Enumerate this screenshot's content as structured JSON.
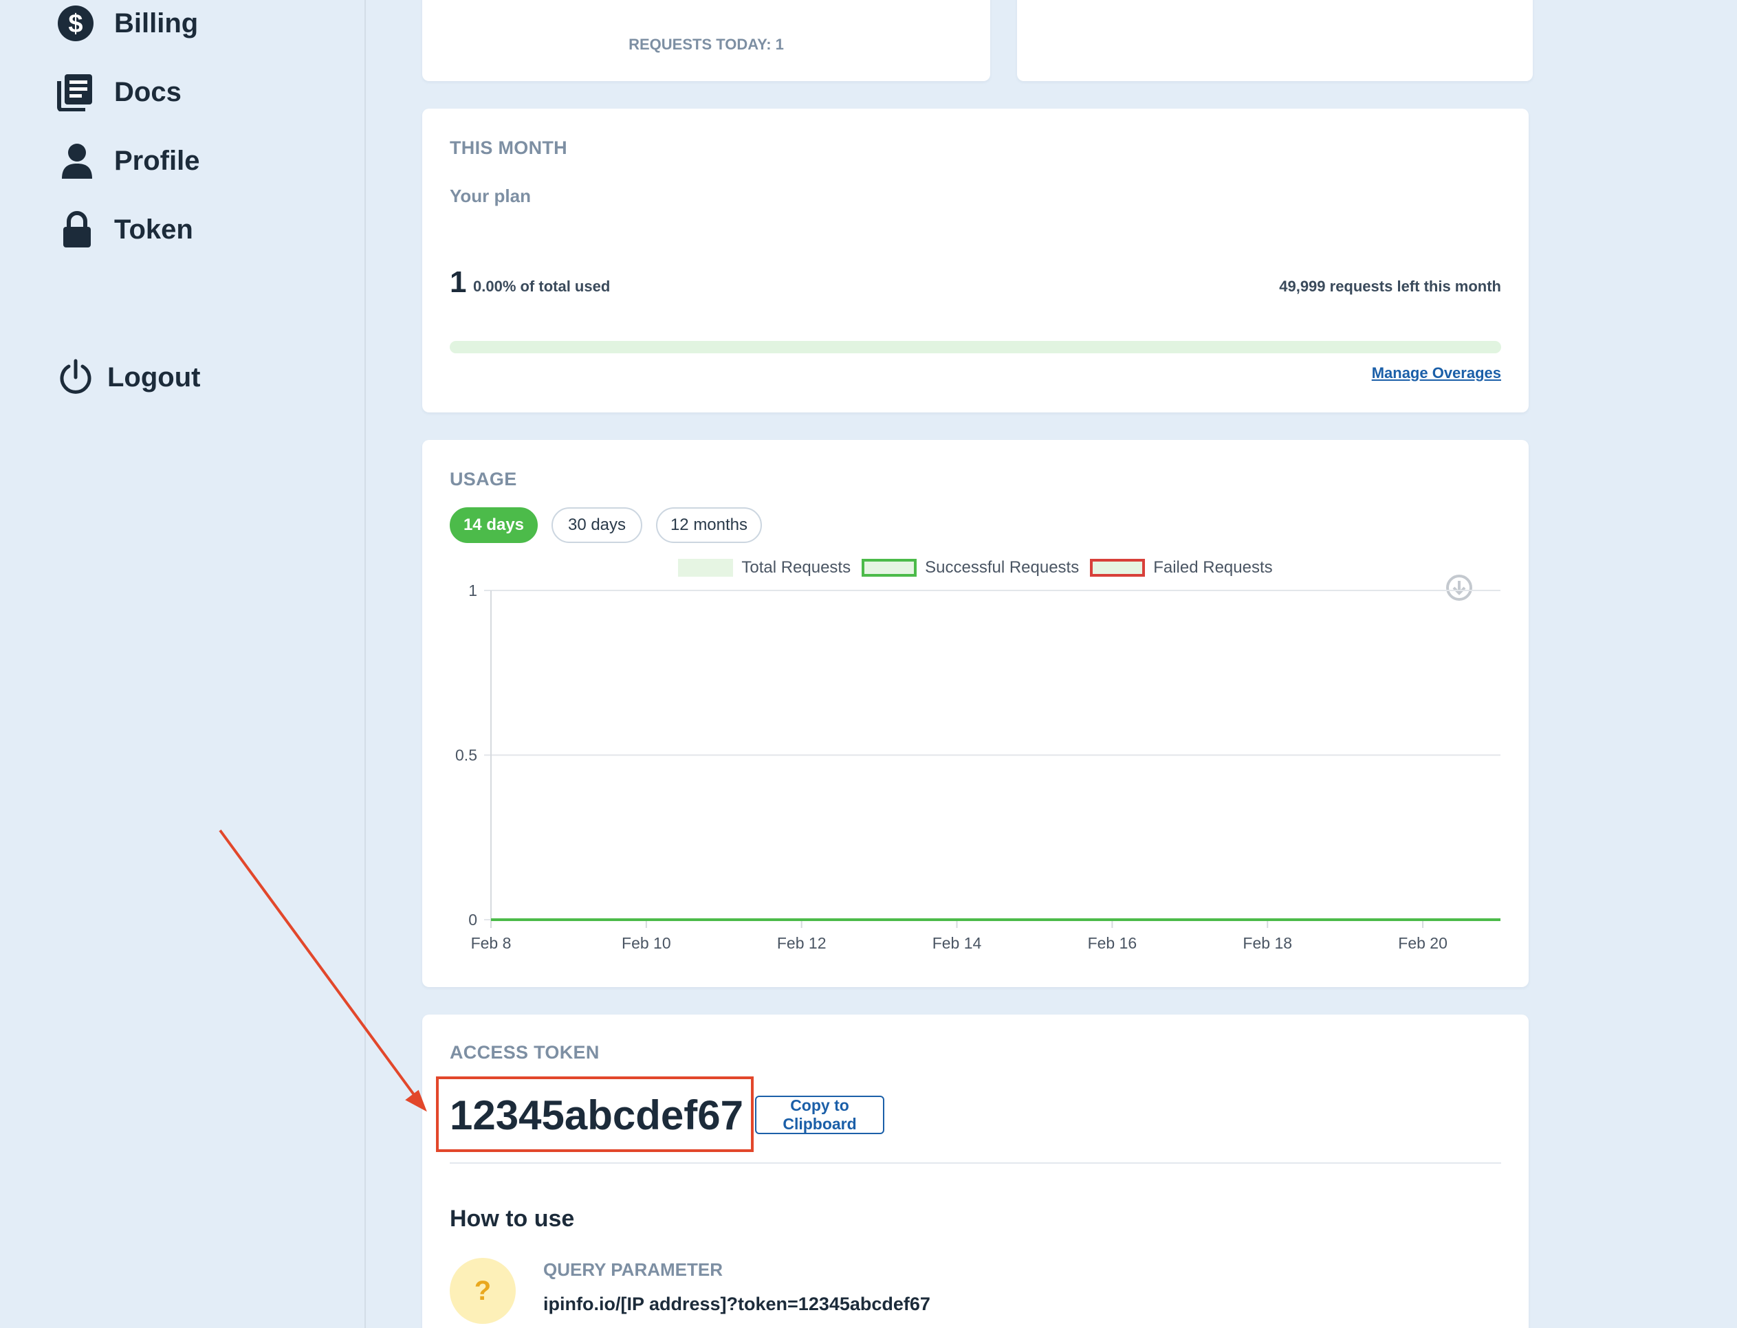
{
  "sidebar": {
    "items": [
      {
        "label": "Billing",
        "icon": "dollar-icon"
      },
      {
        "label": "Docs",
        "icon": "docs-icon"
      },
      {
        "label": "Profile",
        "icon": "user-icon"
      },
      {
        "label": "Token",
        "icon": "lock-icon"
      }
    ],
    "logout": {
      "label": "Logout",
      "icon": "power-icon"
    }
  },
  "top_card": {
    "requests_today": "REQUESTS TODAY: 1"
  },
  "this_month": {
    "title": "THIS MONTH",
    "plan_label": "Your plan",
    "used_count": "1",
    "used_percent_text": "0.00% of total used",
    "requests_left_text": "49,999 requests left this month",
    "usage_fraction": 0.0,
    "manage_link": "Manage Overages"
  },
  "usage": {
    "title": "USAGE",
    "ranges": [
      {
        "label": "14 days",
        "active": true
      },
      {
        "label": "30 days",
        "active": false
      },
      {
        "label": "12 months",
        "active": false
      }
    ]
  },
  "chart_data": {
    "type": "line",
    "x": [
      "Feb 8",
      "Feb 9",
      "Feb 10",
      "Feb 11",
      "Feb 12",
      "Feb 13",
      "Feb 14",
      "Feb 15",
      "Feb 16",
      "Feb 17",
      "Feb 18",
      "Feb 19",
      "Feb 20",
      "Feb 21"
    ],
    "x_tick_labels": [
      "Feb 8",
      "Feb 10",
      "Feb 12",
      "Feb 14",
      "Feb 16",
      "Feb 18",
      "Feb 20"
    ],
    "y_tick_labels": [
      "1",
      "0.5",
      "0"
    ],
    "ylim": [
      0,
      1
    ],
    "grid": true,
    "legend_position": "top-center",
    "series": [
      {
        "name": "Total Requests",
        "values": [
          0,
          0,
          0,
          0,
          0,
          0,
          0,
          0,
          0,
          0,
          0,
          0,
          0,
          0
        ],
        "color": "#e6f5e3",
        "border": "#e6f5e3"
      },
      {
        "name": "Successful Requests",
        "values": [
          0,
          0,
          0,
          0,
          0,
          0,
          0,
          0,
          0,
          0,
          0,
          0,
          0,
          0
        ],
        "color": "#e6f5e3",
        "border": "#4cbb4a"
      },
      {
        "name": "Failed Requests",
        "values": [
          0,
          0,
          0,
          0,
          0,
          0,
          0,
          0,
          0,
          0,
          0,
          0,
          0,
          0
        ],
        "color": "#e6f5e3",
        "border": "#d8403a"
      }
    ]
  },
  "access_token": {
    "title": "ACCESS TOKEN",
    "value": "12345abcdef67",
    "copy_label": "Copy to Clipboard",
    "how_to_use": "How to use",
    "query_param_title": "QUERY PARAMETER",
    "query_param_url": "ipinfo.io/[IP address]?token=12345abcdef67",
    "help_glyph": "?"
  },
  "colors": {
    "accent_green": "#4cbb4a",
    "link_blue": "#1b5fa8",
    "annotation_red": "#e2472b",
    "background": "#e3edf7"
  }
}
